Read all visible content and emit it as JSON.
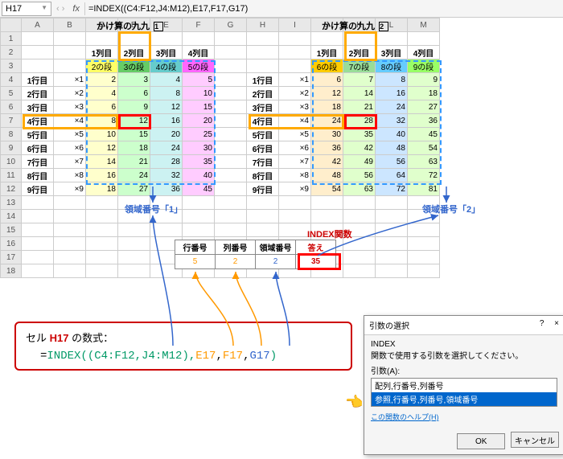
{
  "namebox": "H17",
  "formula": "=INDEX((C4:F12,J4:M12),E17,F17,G17)",
  "colHeaders": [
    "",
    "A",
    "B",
    "C",
    "D",
    "E",
    "F",
    "G",
    "H",
    "I",
    "J",
    "K",
    "L",
    "M"
  ],
  "table1": {
    "title": "かけ算の九九",
    "badge": "1",
    "colLabels": [
      "1列目",
      "2列目",
      "3列目",
      "4列目"
    ],
    "danLabels": [
      "2の段",
      "3の段",
      "4の段",
      "5の段"
    ],
    "rowLabels": [
      "1行目",
      "2行目",
      "3行目",
      "4行目",
      "5行目",
      "6行目",
      "7行目",
      "8行目",
      "9行目"
    ],
    "mults": [
      "×1",
      "×2",
      "×3",
      "×4",
      "×5",
      "×6",
      "×7",
      "×8",
      "×9"
    ],
    "data": [
      [
        2,
        3,
        4,
        5
      ],
      [
        4,
        6,
        8,
        10
      ],
      [
        6,
        9,
        12,
        15
      ],
      [
        8,
        12,
        16,
        20
      ],
      [
        10,
        15,
        20,
        25
      ],
      [
        12,
        18,
        24,
        30
      ],
      [
        14,
        21,
        28,
        35
      ],
      [
        16,
        24,
        32,
        40
      ],
      [
        18,
        27,
        36,
        45
      ]
    ]
  },
  "table2": {
    "title": "かけ算の九九",
    "badge": "2",
    "colLabels": [
      "1列目",
      "2列目",
      "3列目",
      "4列目"
    ],
    "danLabels": [
      "6の段",
      "7の段",
      "8の段",
      "9の段"
    ],
    "rowLabels": [
      "1行目",
      "2行目",
      "3行目",
      "4行目",
      "5行目",
      "6行目",
      "7行目",
      "8行目",
      "9行目"
    ],
    "mults": [
      "×1",
      "×2",
      "×3",
      "×4",
      "×5",
      "×6",
      "×7",
      "×8",
      "×9"
    ],
    "data": [
      [
        6,
        7,
        8,
        9
      ],
      [
        12,
        14,
        16,
        18
      ],
      [
        18,
        21,
        24,
        27
      ],
      [
        24,
        28,
        32,
        36
      ],
      [
        30,
        35,
        40,
        45
      ],
      [
        36,
        42,
        48,
        54
      ],
      [
        42,
        49,
        56,
        63
      ],
      [
        48,
        56,
        64,
        72
      ],
      [
        54,
        63,
        72,
        81
      ]
    ]
  },
  "annotations": {
    "area1": "領域番号「1」",
    "area2": "領域番号「2」",
    "indexFn": "INDEX関数"
  },
  "params": {
    "headers": [
      "行番号",
      "列番号",
      "領域番号",
      "答え"
    ],
    "values": [
      "5",
      "2",
      "2",
      "35"
    ]
  },
  "formulaBox": {
    "prefix": "セル ",
    "cell": "H17",
    "suffix": " の数式：",
    "eq": "=",
    "fn": "INDEX",
    "range": "((C4:F12,J4:M12),",
    "a1": "E17",
    "a2": "F17",
    "a3": "G17",
    "close": ")"
  },
  "dialog": {
    "title": "引数の選択",
    "help": "?",
    "close": "×",
    "fn": "INDEX",
    "desc": "関数で使用する引数を選択してください。",
    "argLabel": "引数(A):",
    "opt1": "配列,行番号,列番号",
    "opt2": "参照,行番号,列番号,領域番号",
    "link": "この関数のヘルプ(H)",
    "ok": "OK",
    "cancel": "キャンセル"
  }
}
